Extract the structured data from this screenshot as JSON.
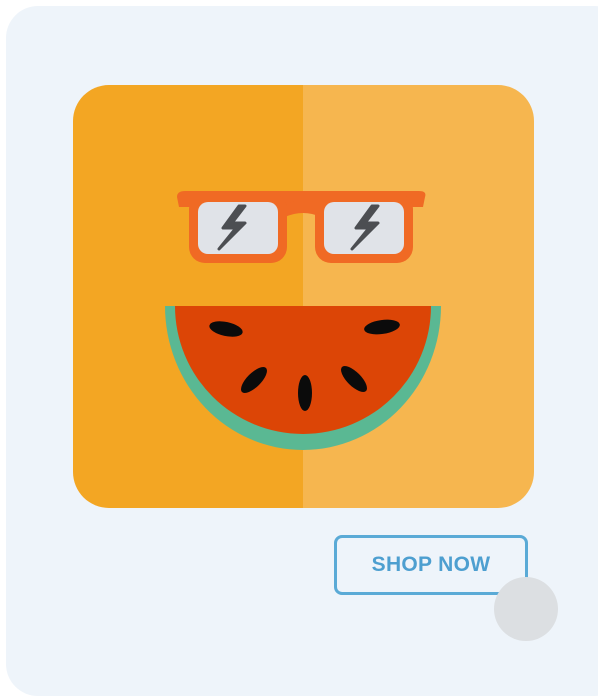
{
  "product_card": {
    "image_icon": "watermell-with-sunglasses-icon",
    "shop_button_label": "SHOP NOW"
  },
  "colors": {
    "card_background": "#eef4fa",
    "tile_left": "#f3a623",
    "tile_right": "#f6b64f",
    "glasses_frame": "#f06a24",
    "lens": "#e0e3e8",
    "bolt": "#4c4e52",
    "rind": "#5ab893",
    "flesh": "#dc4506",
    "seed": "#0b0b0b",
    "button_accent": "#5aaad6"
  }
}
